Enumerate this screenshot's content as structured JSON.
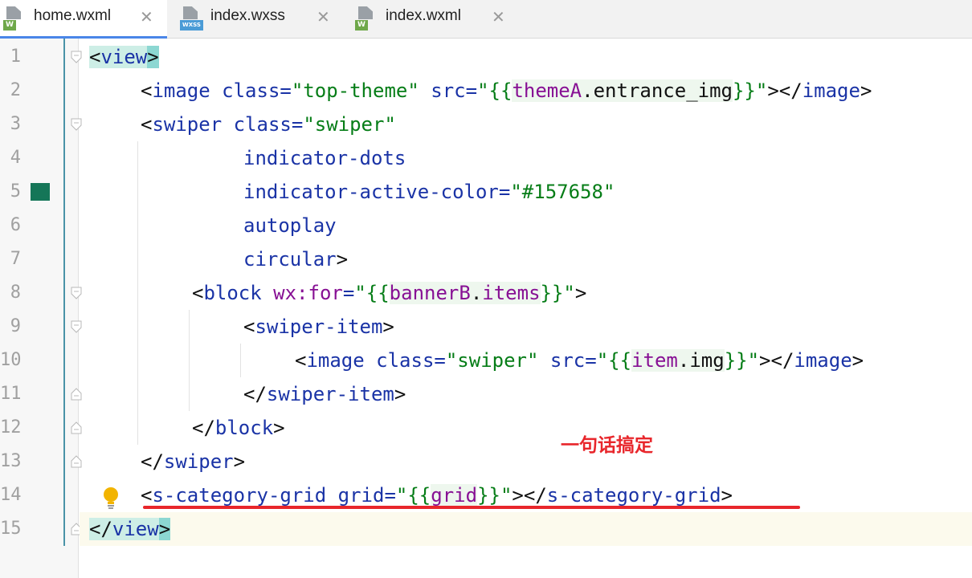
{
  "tabs": [
    {
      "label": "home.wxml",
      "badge": "W",
      "badge_color": "#6fa84a",
      "active": true
    },
    {
      "label": "index.wxss",
      "badge": "WXSS",
      "badge_color": "#4a9bd6",
      "active": false
    },
    {
      "label": "index.wxml",
      "badge": "W",
      "badge_color": "#6fa84a",
      "active": false
    }
  ],
  "close_glyph": "✕",
  "line_numbers": [
    "1",
    "2",
    "3",
    "4",
    "5",
    "6",
    "7",
    "8",
    "9",
    "10",
    "11",
    "12",
    "13",
    "14",
    "15"
  ],
  "code": {
    "l1": {
      "open": "<",
      "tag": "view",
      "close": ">"
    },
    "l2": {
      "a": "<",
      "tag": "image",
      "b": " ",
      "attr1": "class",
      "eq1": "=",
      "val1": "\"top-theme\"",
      "c": " ",
      "attr2": "src",
      "eq2": "=",
      "q1": "\"{{",
      "var1": "themeA",
      "dot": ".",
      "var2": "entrance_img",
      "q2": "}}\"",
      "end": "></",
      "tag2": "image",
      "gt": ">"
    },
    "l3": {
      "a": "<",
      "tag": "swiper",
      "b": " ",
      "attr": "class",
      "eq": "=",
      "val": "\"swiper\""
    },
    "l4": {
      "attr": "indicator-dots"
    },
    "l5": {
      "attr": "indicator-active-color",
      "eq": "=",
      "val": "\"#157658\""
    },
    "l6": {
      "attr": "autoplay"
    },
    "l7": {
      "attr": "circular",
      "gt": ">"
    },
    "l8": {
      "a": "<",
      "tag": "block",
      "b": " ",
      "attr": "wx:for",
      "eq": "=",
      "q1": "\"{{",
      "var1": "bannerB",
      "dot": ".",
      "var2": "items",
      "q2": "}}\"",
      "gt": ">"
    },
    "l9": {
      "a": "<",
      "tag": "swiper-item",
      "gt": ">"
    },
    "l10": {
      "a": "<",
      "tag": "image",
      "b": " ",
      "attr1": "class",
      "eq1": "=",
      "val1": "\"swiper\"",
      "c": " ",
      "attr2": "src",
      "eq2": "=",
      "q1": "\"{{",
      "var1": "item",
      "dot": ".",
      "var2": "img",
      "q2": "}}\"",
      "end": "></",
      "tag2": "image",
      "gt": ">"
    },
    "l11": {
      "a": "</",
      "tag": "swiper-item",
      "gt": ">"
    },
    "l12": {
      "a": "</",
      "tag": "block",
      "gt": ">"
    },
    "l13": {
      "a": "</",
      "tag": "swiper",
      "gt": ">"
    },
    "l14": {
      "a": "<",
      "tag": "s-category-grid",
      "b": " ",
      "attr": "grid",
      "eq": "=",
      "q1": "\"{{",
      "var1": "grid",
      "q2": "}}\"",
      "end": "></",
      "tag2": "s-category-grid",
      "gt": ">"
    },
    "l15": {
      "open": "</",
      "tag": "view",
      "close": ">"
    }
  },
  "annotation": "一句话搞定",
  "colors": {
    "marker": "#157658",
    "annotation": "#e8262b",
    "tab_active_underline": "#4a86e8"
  }
}
